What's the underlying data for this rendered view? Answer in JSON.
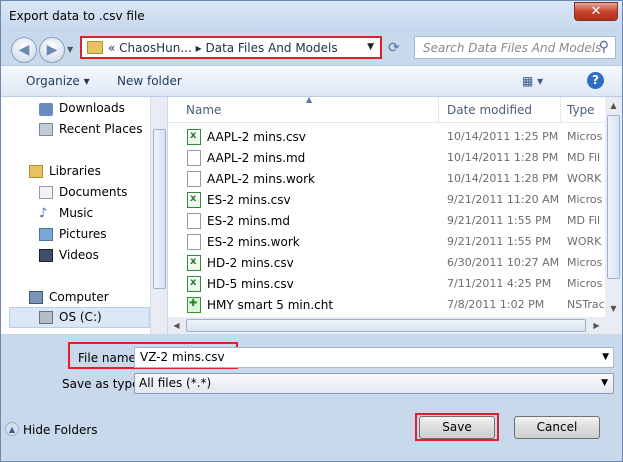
{
  "window": {
    "title": "Export data to .csv file",
    "close_label": "✕"
  },
  "address": {
    "crumbs_prefix": "«",
    "crumb1": "ChaosHun...",
    "separator": "▸",
    "crumb2": "Data Files And Models"
  },
  "search": {
    "placeholder": "Search Data Files And Models"
  },
  "toolbar": {
    "organize": "Organize ▾",
    "new_folder": "New folder"
  },
  "nav": {
    "items": [
      "Downloads",
      "Recent Places",
      "Libraries",
      "Documents",
      "Music",
      "Pictures",
      "Videos",
      "Computer",
      "OS (C:)"
    ]
  },
  "columns": {
    "name": "Name",
    "date": "Date modified",
    "type": "Type"
  },
  "files": [
    {
      "name": "AAPL-2 mins.csv",
      "date": "10/14/2011 1:25 PM",
      "type": "Micros",
      "icon": "csv"
    },
    {
      "name": "AAPL-2 mins.md",
      "date": "10/14/2011 1:28 PM",
      "type": "MD Fil",
      "icon": "doc"
    },
    {
      "name": "AAPL-2 mins.work",
      "date": "10/14/2011 1:28 PM",
      "type": "WORK",
      "icon": "doc"
    },
    {
      "name": "ES-2 mins.csv",
      "date": "9/21/2011 11:20 AM",
      "type": "Micros",
      "icon": "csv"
    },
    {
      "name": "ES-2 mins.md",
      "date": "9/21/2011 1:55 PM",
      "type": "MD Fil",
      "icon": "doc"
    },
    {
      "name": "ES-2 mins.work",
      "date": "9/21/2011 1:55 PM",
      "type": "WORK",
      "icon": "doc"
    },
    {
      "name": "HD-2 mins.csv",
      "date": "6/30/2011 10:27 AM",
      "type": "Micros",
      "icon": "csv"
    },
    {
      "name": "HD-5 mins.csv",
      "date": "7/11/2011 4:25 PM",
      "type": "Micros",
      "icon": "csv"
    },
    {
      "name": "HMY smart 5 min.cht",
      "date": "7/8/2011 1:02 PM",
      "type": "NSTrac",
      "icon": "cht"
    }
  ],
  "form": {
    "filename_label": "File name:",
    "filename_value": "VZ-2 mins.csv",
    "type_label": "Save as type:",
    "type_value": "All files (*.*)"
  },
  "footer": {
    "hide_folders": "Hide Folders",
    "save": "Save",
    "cancel": "Cancel"
  }
}
